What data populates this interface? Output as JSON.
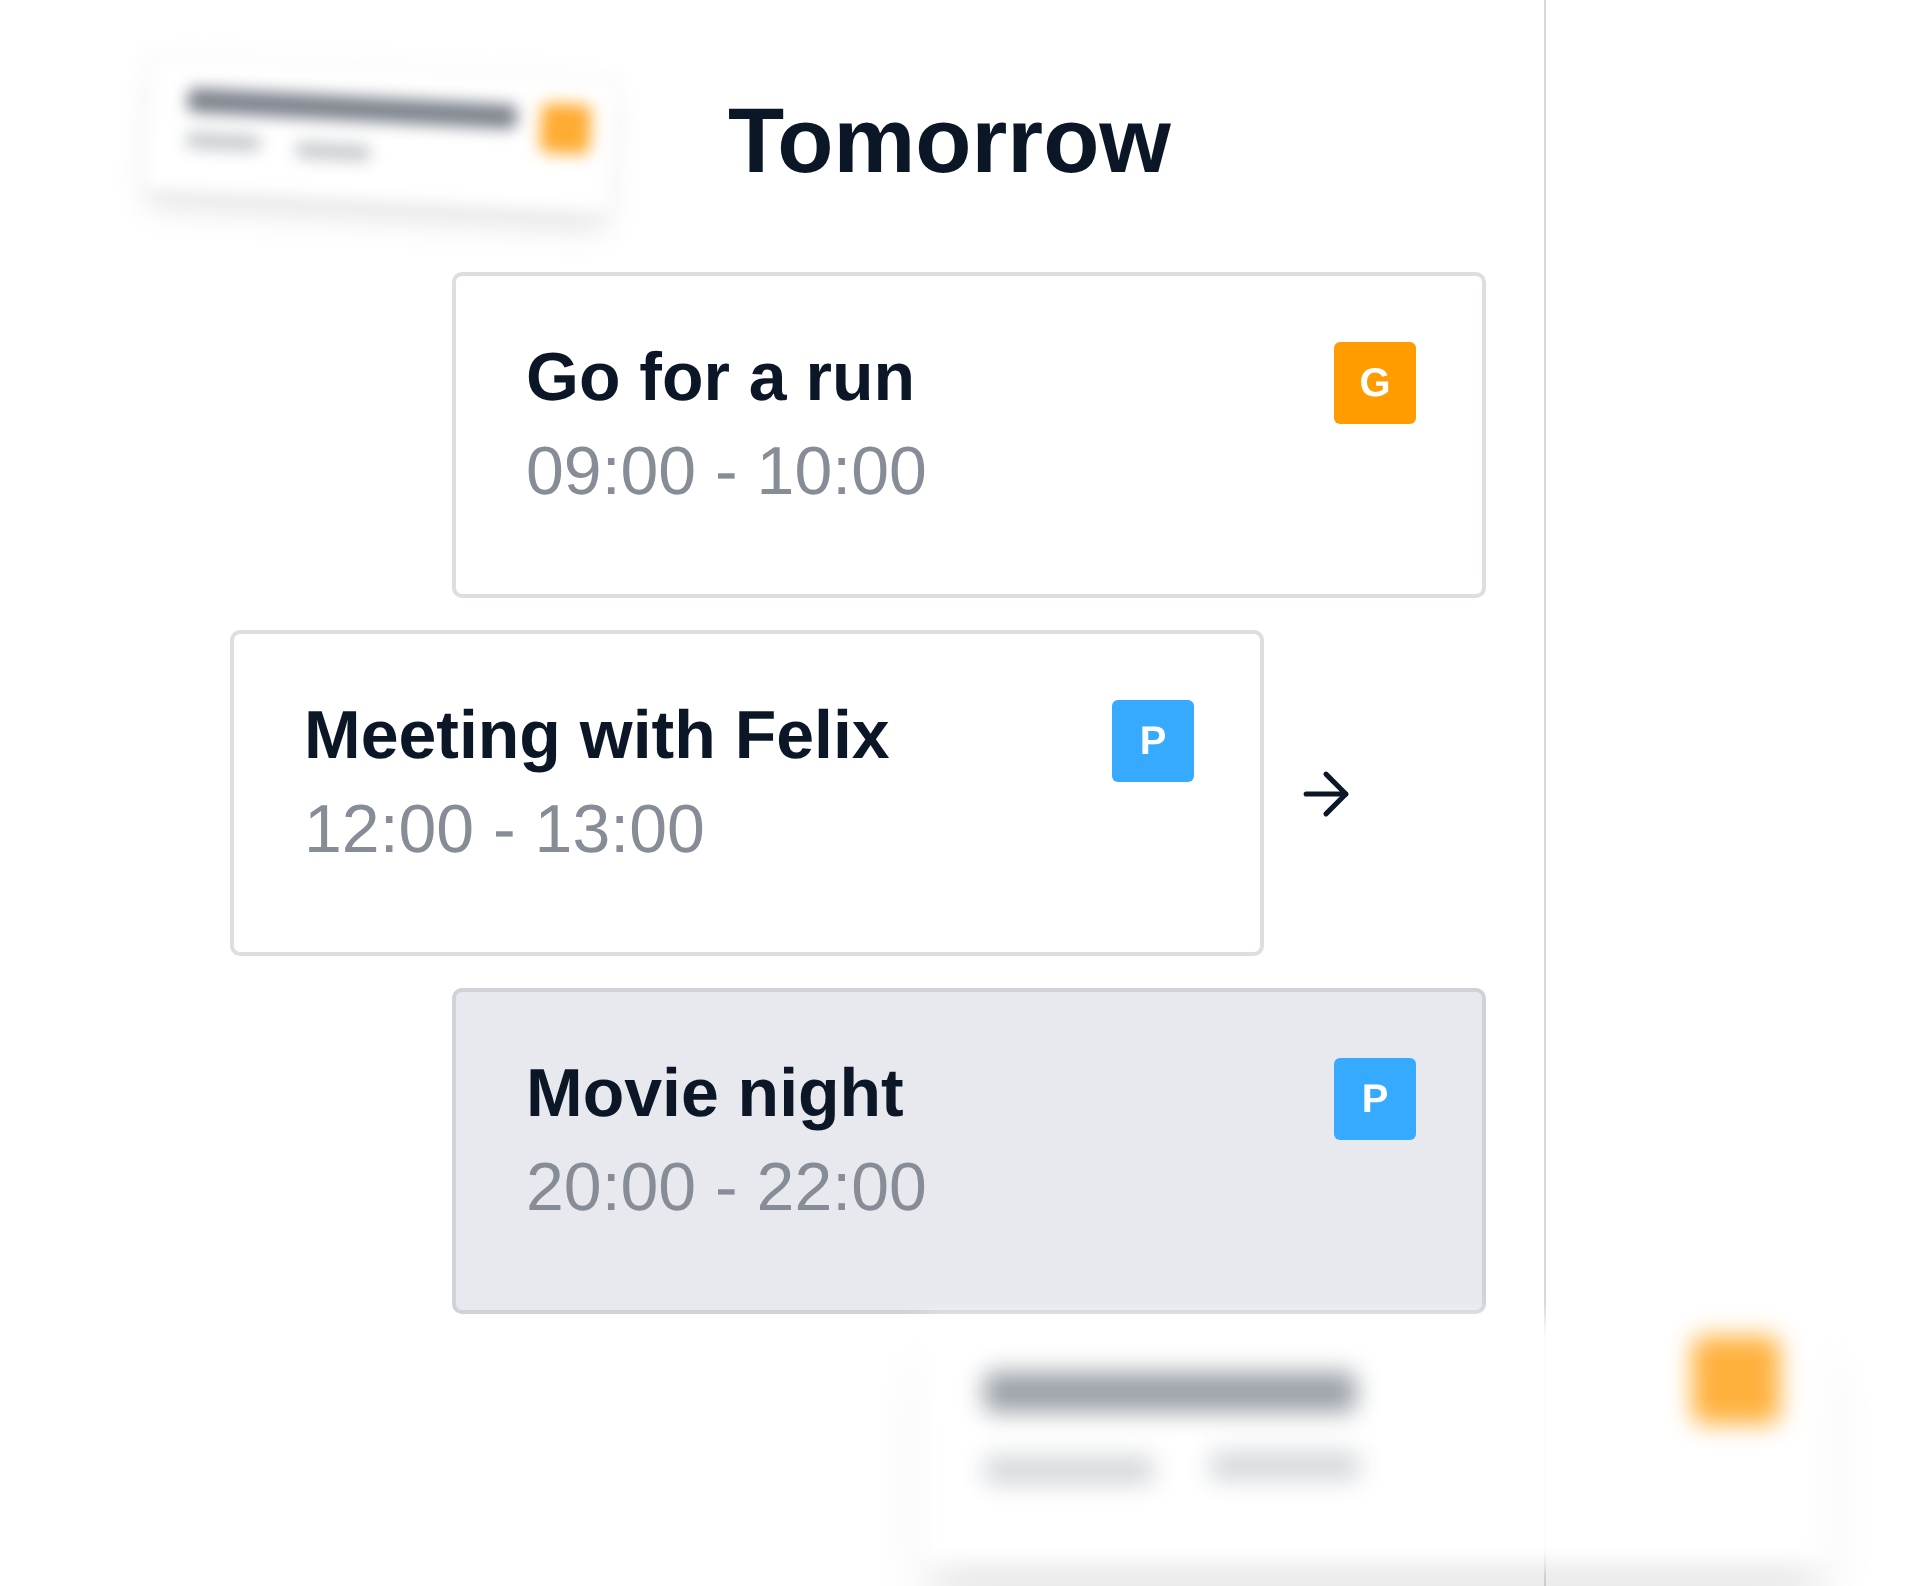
{
  "day_heading": "Tomorrow",
  "events": [
    {
      "title": "Go for a run",
      "time": "09:00 - 10:00",
      "tag": "G",
      "color": "#ff9c00",
      "selected": false,
      "dragging": false
    },
    {
      "title": "Meeting with Felix",
      "time": "12:00 - 13:00",
      "tag": "P",
      "color": "#35aaff",
      "selected": false,
      "dragging": true
    },
    {
      "title": "Movie night",
      "time": "20:00 - 22:00",
      "tag": "P",
      "color": "#35aaff",
      "selected": true,
      "dragging": false
    }
  ]
}
